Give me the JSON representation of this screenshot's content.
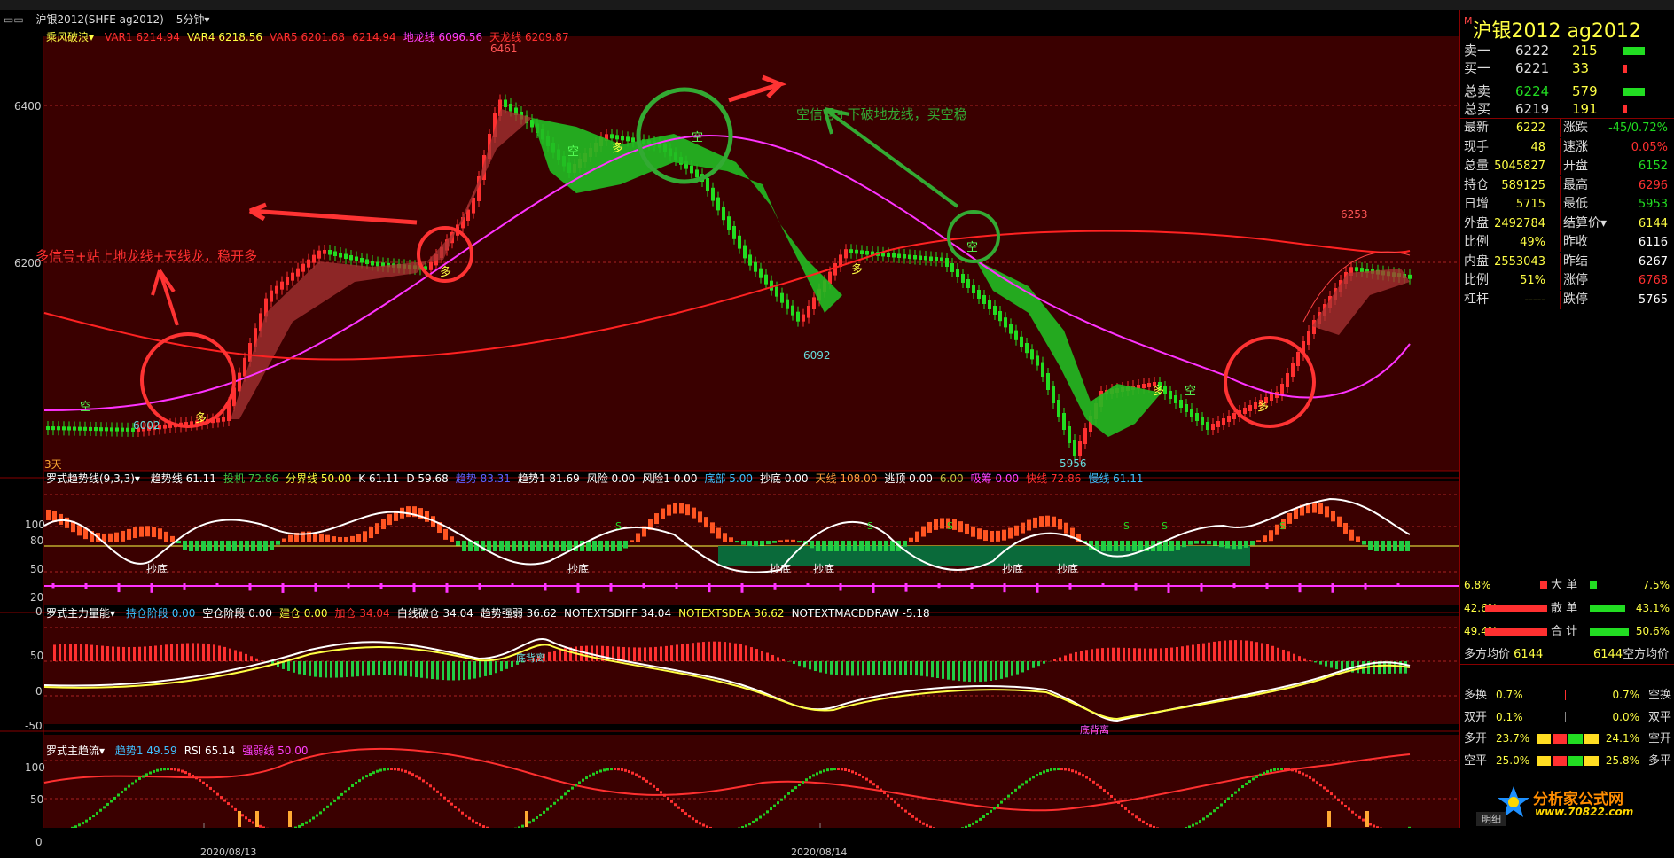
{
  "titlebar": {
    "symbol": "沪银2012(SHFE ag2012)",
    "period": "5分钟"
  },
  "main_panel": {
    "indicator": "乘风破浪",
    "legend": [
      {
        "name": "VAR1",
        "value": "6214.94",
        "color": "#ff3030"
      },
      {
        "name": "VAR4",
        "value": "6218.56",
        "color": "#ffff40"
      },
      {
        "name": "VAR5",
        "value": "6201.68",
        "color": "#ff3030"
      },
      {
        "name": "",
        "value": "6214.94",
        "color": "#ff3030"
      },
      {
        "name": "地龙线",
        "value": "6096.56",
        "color": "#ff40ff"
      },
      {
        "name": "天龙线",
        "value": "6209.87",
        "color": "#ff3030"
      }
    ],
    "y_ticks": [
      "6400",
      "6200"
    ],
    "price_labels": [
      "6461",
      "6002",
      "6092",
      "5956",
      "6253"
    ],
    "corner_label": "3天",
    "annotation_left": "多信号+站上地龙线+天线龙，稳开多",
    "annotation_right": "空信号+下破地龙线，买空稳",
    "signal_long": "多",
    "signal_short": "空"
  },
  "panel2": {
    "indicator": "罗式趋势线(9,3,3)",
    "legend": [
      {
        "name": "趋势线",
        "value": "61.11",
        "color": "#ffffff"
      },
      {
        "name": "投机",
        "value": "72.86",
        "color": "#40c040"
      },
      {
        "name": "分界线",
        "value": "50.00",
        "color": "#ffff40"
      },
      {
        "name": "K",
        "value": "61.11",
        "color": "#ffffff"
      },
      {
        "name": "D",
        "value": "59.68",
        "color": "#ffffff"
      },
      {
        "name": "趋势",
        "value": "83.31",
        "color": "#6060ff"
      },
      {
        "name": "趋势1",
        "value": "81.69",
        "color": "#ffffff"
      },
      {
        "name": "风险",
        "value": "0.00",
        "color": "#ffffff"
      },
      {
        "name": "风险1",
        "value": "0.00",
        "color": "#ffffff"
      },
      {
        "name": "底部",
        "value": "5.00",
        "color": "#40c0ff"
      },
      {
        "name": "抄底",
        "value": "0.00",
        "color": "#ffffff"
      },
      {
        "name": "天线",
        "value": "108.00",
        "color": "#ffa040"
      },
      {
        "name": "逃顶",
        "value": "0.00",
        "color": "#ffffff"
      },
      {
        "name": "",
        "value": "6.00",
        "color": "#c0c040"
      },
      {
        "name": "吸筹",
        "value": "0.00",
        "color": "#ff40ff"
      },
      {
        "name": "快线",
        "value": "72.86",
        "color": "#ff3030"
      },
      {
        "name": "慢线",
        "value": "61.11",
        "color": "#40c0ff"
      }
    ],
    "y_ticks": [
      "100",
      "80",
      "50",
      "20",
      "0"
    ],
    "marker": "抄底",
    "s_marker": "S"
  },
  "panel3": {
    "indicator": "罗式主力量能",
    "legend": [
      {
        "name": "持仓阶段",
        "value": "0.00",
        "color": "#40c0ff"
      },
      {
        "name": "空仓阶段",
        "value": "0.00",
        "color": "#ffffff"
      },
      {
        "name": "建仓",
        "value": "0.00",
        "color": "#ffff40"
      },
      {
        "name": "加仓",
        "value": "34.04",
        "color": "#ff3030"
      },
      {
        "name": "白线破仓",
        "value": "34.04",
        "color": "#ffffff"
      },
      {
        "name": "趋势强弱",
        "value": "36.62",
        "color": "#ffffff"
      },
      {
        "name": "NOTEXTSDIFF",
        "value": "34.04",
        "color": "#ffffff"
      },
      {
        "name": "NOTEXTSDEA",
        "value": "36.62",
        "color": "#ffff40"
      },
      {
        "name": "NOTEXTMACDDRAW",
        "value": "-5.18",
        "color": "#ffffff"
      }
    ],
    "y_ticks": [
      "50",
      "0",
      "-50"
    ],
    "tag_top": "底背离",
    "tag_bottom": "底背离"
  },
  "panel4": {
    "indicator": "罗式主趋流",
    "legend": [
      {
        "name": "趋势1",
        "value": "49.59",
        "color": "#40c0ff"
      },
      {
        "name": "RSI",
        "value": "65.14",
        "color": "#ffffff"
      },
      {
        "name": "强弱线",
        "value": "50.00",
        "color": "#ff40ff"
      }
    ],
    "y_ticks": [
      "100",
      "50",
      "0"
    ],
    "dates": [
      "2020/08/13",
      "2020/08/14"
    ]
  },
  "sidebar": {
    "title": "沪银2012  ag2012",
    "title_mark": "M",
    "order_book": [
      {
        "label": "卖一",
        "price": "6222",
        "vol": "215",
        "bar": "green"
      },
      {
        "label": "买一",
        "price": "6221",
        "vol": "33",
        "bar": "red"
      },
      {
        "label": "总卖",
        "price": "6224",
        "vol": "579",
        "bar": "green"
      },
      {
        "label": "总买",
        "price": "6219",
        "vol": "191",
        "bar": "red"
      }
    ],
    "stats": [
      {
        "l": "最新",
        "v": "6222",
        "l2": "涨跌",
        "v2": "-45/0.72%"
      },
      {
        "l": "现手",
        "v": "48",
        "l2": "速涨",
        "v2": "0.05%"
      },
      {
        "l": "总量",
        "v": "5045827",
        "l2": "开盘",
        "v2": "6152"
      },
      {
        "l": "持仓",
        "v": "589125",
        "l2": "最高",
        "v2": "6296"
      },
      {
        "l": "日增",
        "v": "5715",
        "l2": "最低",
        "v2": "5953"
      },
      {
        "l": "外盘",
        "v": "2492784",
        "l2": "结算价",
        "v2": "6144"
      },
      {
        "l": "比例",
        "v": "49%",
        "l2": "昨收",
        "v2": "6116"
      },
      {
        "l": "内盘",
        "v": "2553043",
        "l2": "昨结",
        "v2": "6267"
      },
      {
        "l": "比例",
        "v": "51%",
        "l2": "涨停",
        "v2": "6768"
      },
      {
        "l": "杠杆",
        "v": "-----",
        "l2": "跌停",
        "v2": "5765"
      }
    ],
    "flow": [
      {
        "left": "6.8%",
        "label": "大 单",
        "right": "7.5%"
      },
      {
        "left": "42.6%",
        "label": "散 单",
        "right": "43.1%"
      },
      {
        "left": "49.4%",
        "label": "合 计",
        "right": "50.6%"
      }
    ],
    "avg_left_label": "多方均价",
    "avg_left_value": "6144",
    "avg_right_value": "6144",
    "avg_right_label": "空方均价",
    "changes": [
      {
        "l": "多换",
        "lv": "0.7%",
        "rv": "0.7%",
        "r": "空换"
      },
      {
        "l": "双开",
        "lv": "0.1%",
        "rv": "0.0%",
        "r": "双平"
      },
      {
        "l": "多开",
        "lv": "23.7%",
        "rv": "24.1%",
        "r": "空开"
      },
      {
        "l": "空平",
        "lv": "25.0%",
        "rv": "25.8%",
        "r": "多平"
      }
    ],
    "footer_tab": "明细",
    "watermark": "分析家公式网",
    "watermark_url": "www.70822.com"
  }
}
